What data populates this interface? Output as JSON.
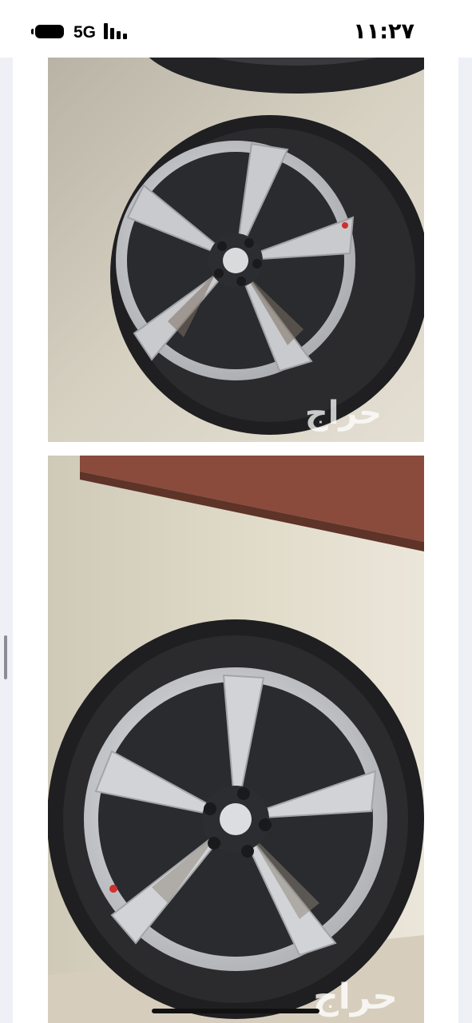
{
  "status_bar": {
    "network": "5G",
    "time": "١١:٢٧",
    "icons": [
      "battery-icon",
      "signal-bars-icon"
    ]
  },
  "photos": [
    {
      "watermark": "حراج"
    },
    {
      "watermark": "حراج"
    }
  ],
  "colors": {
    "background": "#eef0f6",
    "card": "#ffffff",
    "concrete": "#d8d2c3",
    "tire": "#1e1e20",
    "rim_silver": "#cfd0d2",
    "rim_dark": "#2a2b2e"
  }
}
